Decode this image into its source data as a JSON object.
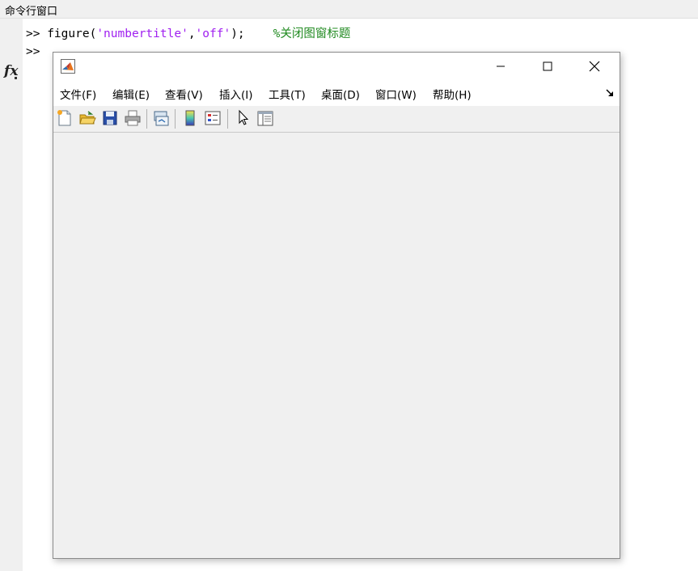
{
  "command_window": {
    "title": "命令行窗口",
    "prompt": ">>",
    "line1_cmd": "figure(",
    "line1_str1": "'numbertitle'",
    "line1_comma": ",",
    "line1_str2": "'off'",
    "line1_end": ");",
    "line1_comment": "%关闭图窗标题",
    "fx_label": "fx"
  },
  "figure_window": {
    "menus": [
      {
        "label": "文件(F)"
      },
      {
        "label": "编辑(E)"
      },
      {
        "label": "查看(V)"
      },
      {
        "label": "插入(I)"
      },
      {
        "label": "工具(T)"
      },
      {
        "label": "桌面(D)"
      },
      {
        "label": "窗口(W)"
      },
      {
        "label": "帮助(H)"
      }
    ],
    "toolbar_icons": [
      "new-figure-icon",
      "open-file-icon",
      "save-icon",
      "print-icon",
      "link-plot-icon",
      "colorbar-icon",
      "legend-icon",
      "edit-plot-icon",
      "property-inspector-icon"
    ]
  },
  "colors": {
    "string": "#a020f0",
    "comment": "#228b22"
  }
}
